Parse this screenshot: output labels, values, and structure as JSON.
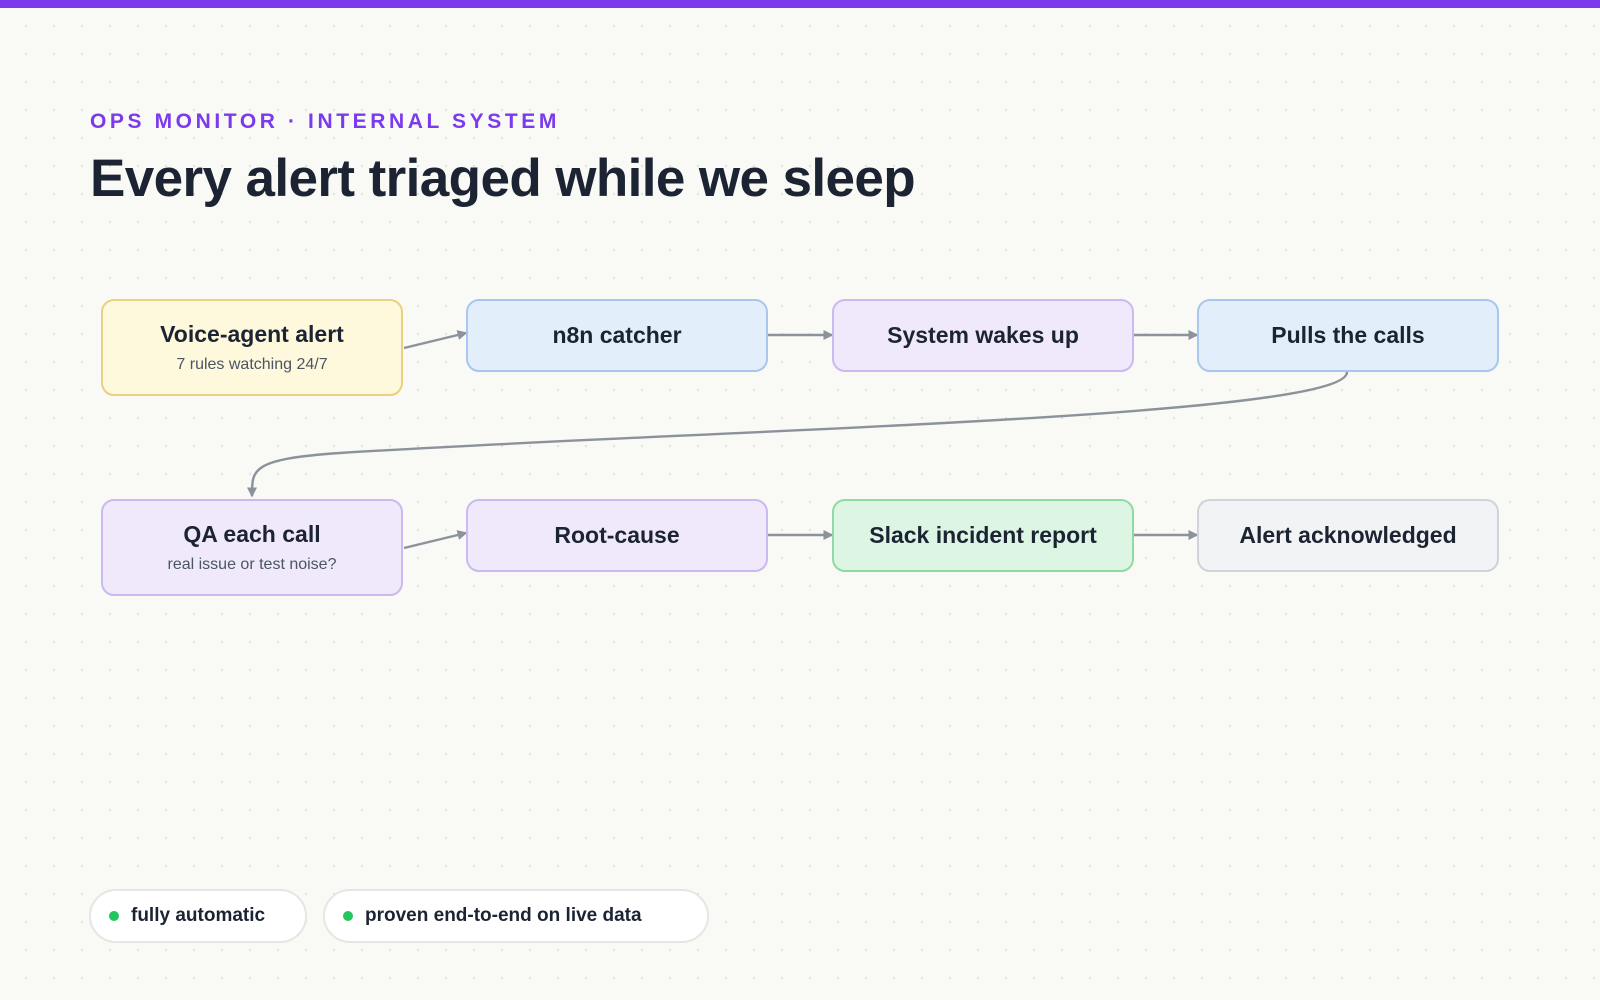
{
  "header": {
    "eyebrow": "OPS MONITOR · INTERNAL SYSTEM",
    "title": "Every alert triaged while we sleep"
  },
  "flow": {
    "nodes": [
      {
        "id": "voice-agent-alert",
        "title": "Voice-agent alert",
        "subtitle": "7 rules watching 24/7",
        "tone": "yellow"
      },
      {
        "id": "n8n-catcher",
        "title": "n8n catcher",
        "tone": "blue"
      },
      {
        "id": "system-wakes-up",
        "title": "System wakes up",
        "tone": "purple"
      },
      {
        "id": "pulls-the-calls",
        "title": "Pulls the calls",
        "tone": "blue"
      },
      {
        "id": "qa-each-call",
        "title": "QA each call",
        "subtitle": "real issue or test noise?",
        "tone": "purple"
      },
      {
        "id": "root-cause",
        "title": "Root-cause",
        "tone": "purple"
      },
      {
        "id": "slack-incident-report",
        "title": "Slack incident report",
        "tone": "green"
      },
      {
        "id": "alert-acknowledged",
        "title": "Alert acknowledged",
        "tone": "gray"
      }
    ],
    "edges": [
      [
        "voice-agent-alert",
        "n8n-catcher"
      ],
      [
        "n8n-catcher",
        "system-wakes-up"
      ],
      [
        "system-wakes-up",
        "pulls-the-calls"
      ],
      [
        "pulls-the-calls",
        "qa-each-call"
      ],
      [
        "qa-each-call",
        "root-cause"
      ],
      [
        "root-cause",
        "slack-incident-report"
      ],
      [
        "slack-incident-report",
        "alert-acknowledged"
      ]
    ]
  },
  "footer": {
    "badges": [
      {
        "label": "fully automatic"
      },
      {
        "label": "proven end-to-end on live data"
      }
    ]
  },
  "colors": {
    "accent": "#7c3aed",
    "connector": "#8b929b",
    "status_dot": "#22c55e"
  }
}
